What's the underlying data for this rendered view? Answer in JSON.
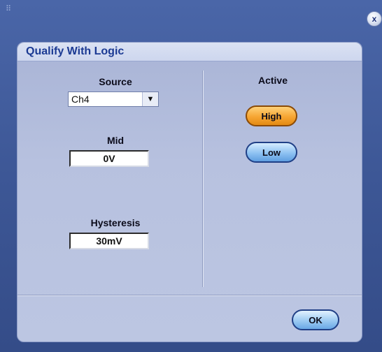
{
  "window": {
    "close_label": "x"
  },
  "panel": {
    "title": "Qualify With Logic"
  },
  "source": {
    "label": "Source",
    "selected": "Ch4",
    "arrow": "▼"
  },
  "mid": {
    "label": "Mid",
    "value": "0V"
  },
  "hysteresis": {
    "label": "Hysteresis",
    "value": "30mV"
  },
  "active": {
    "label": "Active",
    "options": [
      "High",
      "Low"
    ],
    "selected": "High"
  },
  "footer": {
    "ok_label": "OK"
  },
  "colors": {
    "active_pill": "#f6a532",
    "inactive_pill": "#8ec2f2",
    "title_text": "#1b3a93"
  }
}
